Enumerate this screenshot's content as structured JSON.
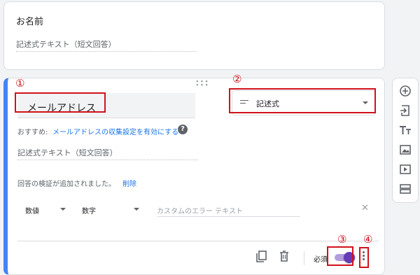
{
  "name_question": {
    "title": "お名前",
    "answer_placeholder": "記述式テキスト（短文回答）"
  },
  "email_question": {
    "title": "メールアドレス",
    "type_label": "記述式",
    "suggestion_prefix": "おすすめ:",
    "suggestion_link": "メールアドレスの収集設定を有効にする",
    "answer_placeholder": "記述式テキスト（短文回答）",
    "validation_message": "回答の検証が追加されました。",
    "delete_label": "削除",
    "validation_type": "数値",
    "validation_condition": "数字",
    "error_placeholder": "カスタムのエラー テキスト",
    "required_label": "必須",
    "required_on": true
  },
  "annotations": [
    "①",
    "②",
    "③",
    "④"
  ],
  "colors": {
    "accent_purple": "#673ab7",
    "focus_blue": "#4285f4",
    "annotation_red": "#d0121b",
    "link_blue": "#1a73e8"
  },
  "side_toolbar": [
    "add-question-icon",
    "import-questions-icon",
    "add-title-icon",
    "add-image-icon",
    "add-video-icon",
    "add-section-icon"
  ]
}
